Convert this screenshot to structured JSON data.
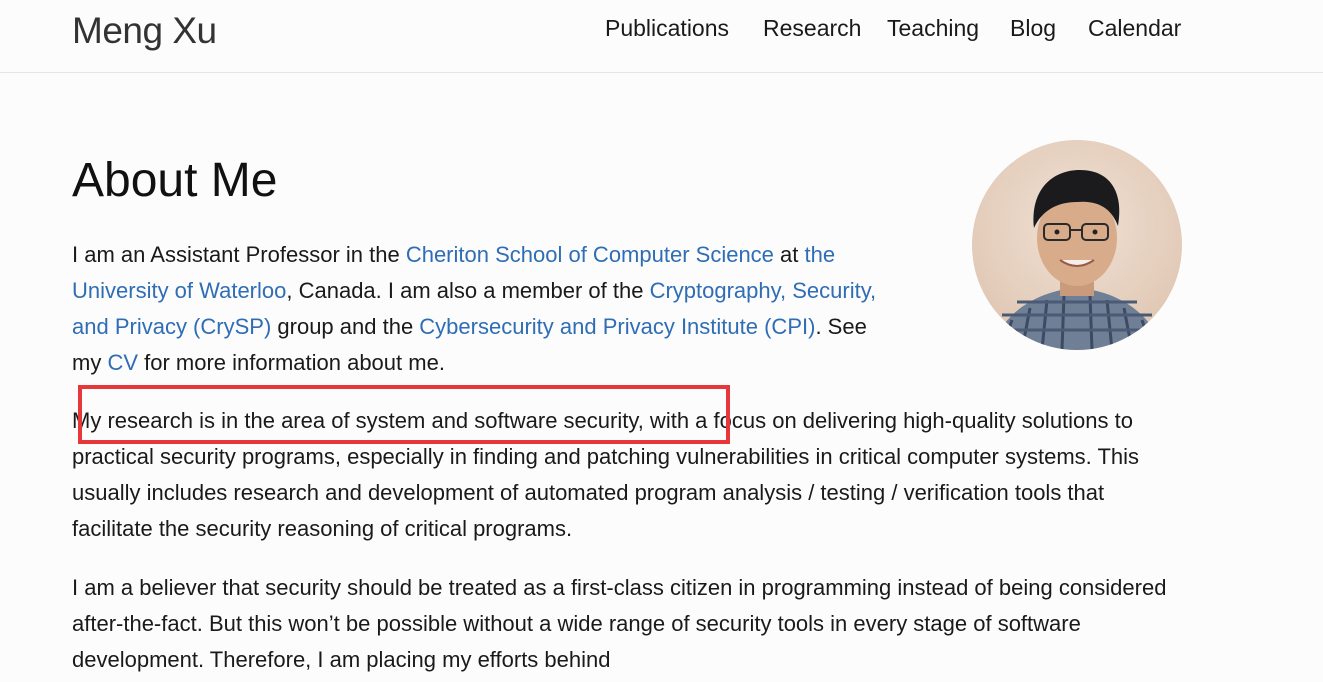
{
  "site": {
    "title": "Meng Xu"
  },
  "nav": {
    "items": [
      {
        "label": "Publications"
      },
      {
        "label": "Research"
      },
      {
        "label": "Teaching"
      },
      {
        "label": "Blog"
      },
      {
        "label": "Calendar"
      }
    ]
  },
  "main": {
    "heading": "About Me",
    "para1": {
      "t1": "I am an Assistant Professor in the ",
      "link_cs": "Cheriton School of Computer Science",
      "t2": " at ",
      "link_uw": "the University of Waterloo",
      "t3": ", Canada. I am also a member of the ",
      "link_crysp": "Cryptography, Security, and Privacy (CrySP)",
      "t4": " group and the ",
      "link_cpi": "Cybersecurity and Privacy Institute (CPI)",
      "t5": ". See my ",
      "link_cv": "CV",
      "t6": " for more information about me."
    },
    "para2": "My research is in the area of system and software security, with a focus on delivering high-quality solutions to practical security programs, especially in finding and patching vulnerabilities in critical computer systems. This usually includes research and development of automated program analysis / testing / verification tools that facilitate the security reasoning of critical programs.",
    "para3": "I am a believer that security should be treated as a first-class citizen in programming instead of being considered after-the-fact. But this won’t be possible without a wide range of security tools in every stage of software development. Therefore, I am placing my efforts behind"
  },
  "colors": {
    "link": "#2f6db5",
    "highlight_box": "#e8373a"
  }
}
